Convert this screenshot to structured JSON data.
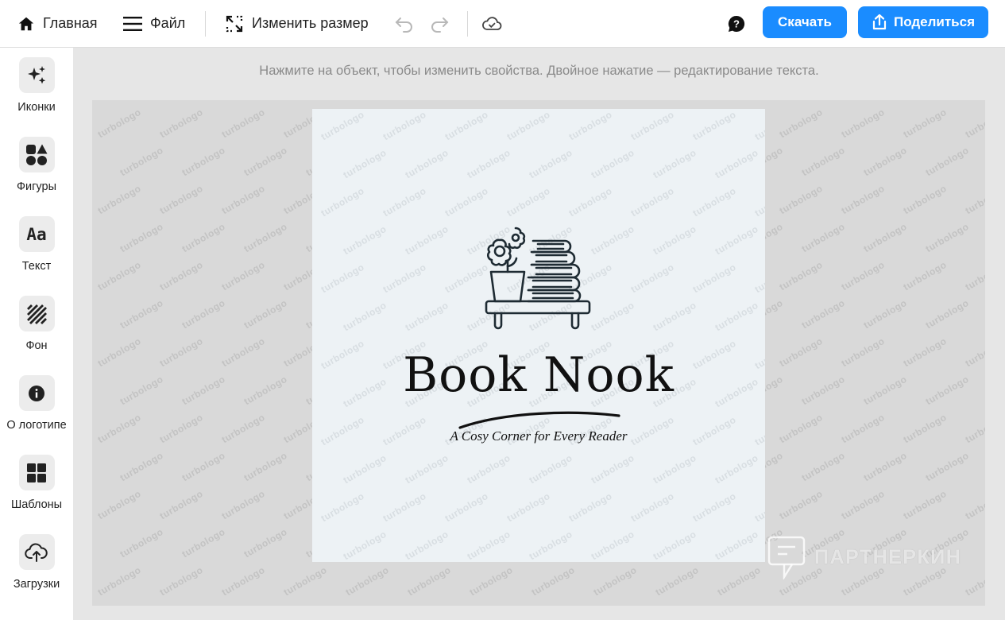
{
  "topbar": {
    "home_label": "Главная",
    "file_label": "Файл",
    "resize_label": "Изменить размер",
    "download_label": "Скачать",
    "share_label": "Поделиться"
  },
  "sidebar": {
    "items": [
      {
        "label": "Иконки",
        "icon": "sparkles-icon"
      },
      {
        "label": "Фигуры",
        "icon": "shapes-icon"
      },
      {
        "label": "Текст",
        "icon": "text-icon"
      },
      {
        "label": "Фон",
        "icon": "background-icon"
      },
      {
        "label": "О логотипе",
        "icon": "info-icon"
      },
      {
        "label": "Шаблоны",
        "icon": "templates-icon"
      },
      {
        "label": "Загрузки",
        "icon": "upload-icon"
      }
    ]
  },
  "hint": "Нажмите на объект, чтобы изменить свойства. Двойное нажатие — редактирование текста.",
  "logo": {
    "title": "Book Nook",
    "slogan": "A Cosy Corner for Every Reader",
    "ink_color": "#1e2b33"
  },
  "watermark": "turbologo",
  "overlay_watermark": "ПАРТНЕРКИН",
  "colors": {
    "accent": "#1a8cff",
    "canvas": "#d9d9d9",
    "artboard": "#edf2f5"
  }
}
